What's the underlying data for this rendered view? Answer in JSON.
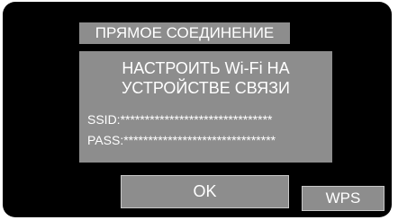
{
  "dialog": {
    "title": "ПРЯМОЕ СОЕДИНЕНИЕ",
    "message_line1": "НАСТРОИТЬ Wi-Fi НА",
    "message_line2": "УСТРОЙСТВЕ СВЯЗИ",
    "ssid": "SSID:*******************************",
    "password": "PASS:*******************************"
  },
  "buttons": {
    "ok_label": "OK",
    "wps_label": "WPS"
  },
  "colors": {
    "background": "#000000",
    "panel": "#8d8d8d",
    "text": "#ffffff"
  }
}
